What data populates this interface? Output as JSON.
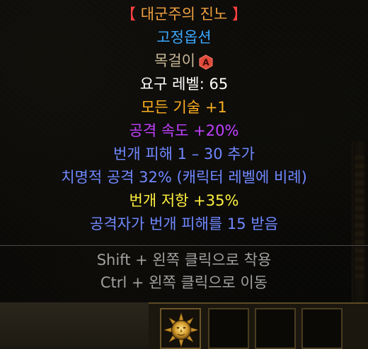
{
  "tooltip": {
    "title_open": "【 ",
    "title_name": "대군주의 진노",
    "title_close": " 】",
    "rarity": "고정옵션",
    "item_type": "목걸이",
    "badge_icon": "ascended-badge-icon",
    "badge_letter": "A",
    "lines": [
      "요구 레벨: 65",
      "모든 기술 +1",
      "공격 속도 +20%",
      "번개 피해 1 – 30 추가",
      "치명적 공격 32% (캐릭터 레벨에 비례)",
      "번개 저항 +35%",
      "공격자가 번개 피해를 15 받음"
    ],
    "hints": [
      "Shift + 왼쪽 클릭으로 착용",
      "Ctrl + 왼쪽 클릭으로 이동"
    ]
  },
  "inventory": {
    "slot_item_icon": "sun-amulet-icon"
  },
  "colors": {
    "unique_title": "#f0a040",
    "bracket": "#ff4040",
    "set_label": "#3aa8ff",
    "magic_blue": "#7088ff",
    "purple": "#c040ff",
    "yellow": "#fff040",
    "orange": "#ffb020",
    "hint_gray": "#a0a0a0"
  }
}
